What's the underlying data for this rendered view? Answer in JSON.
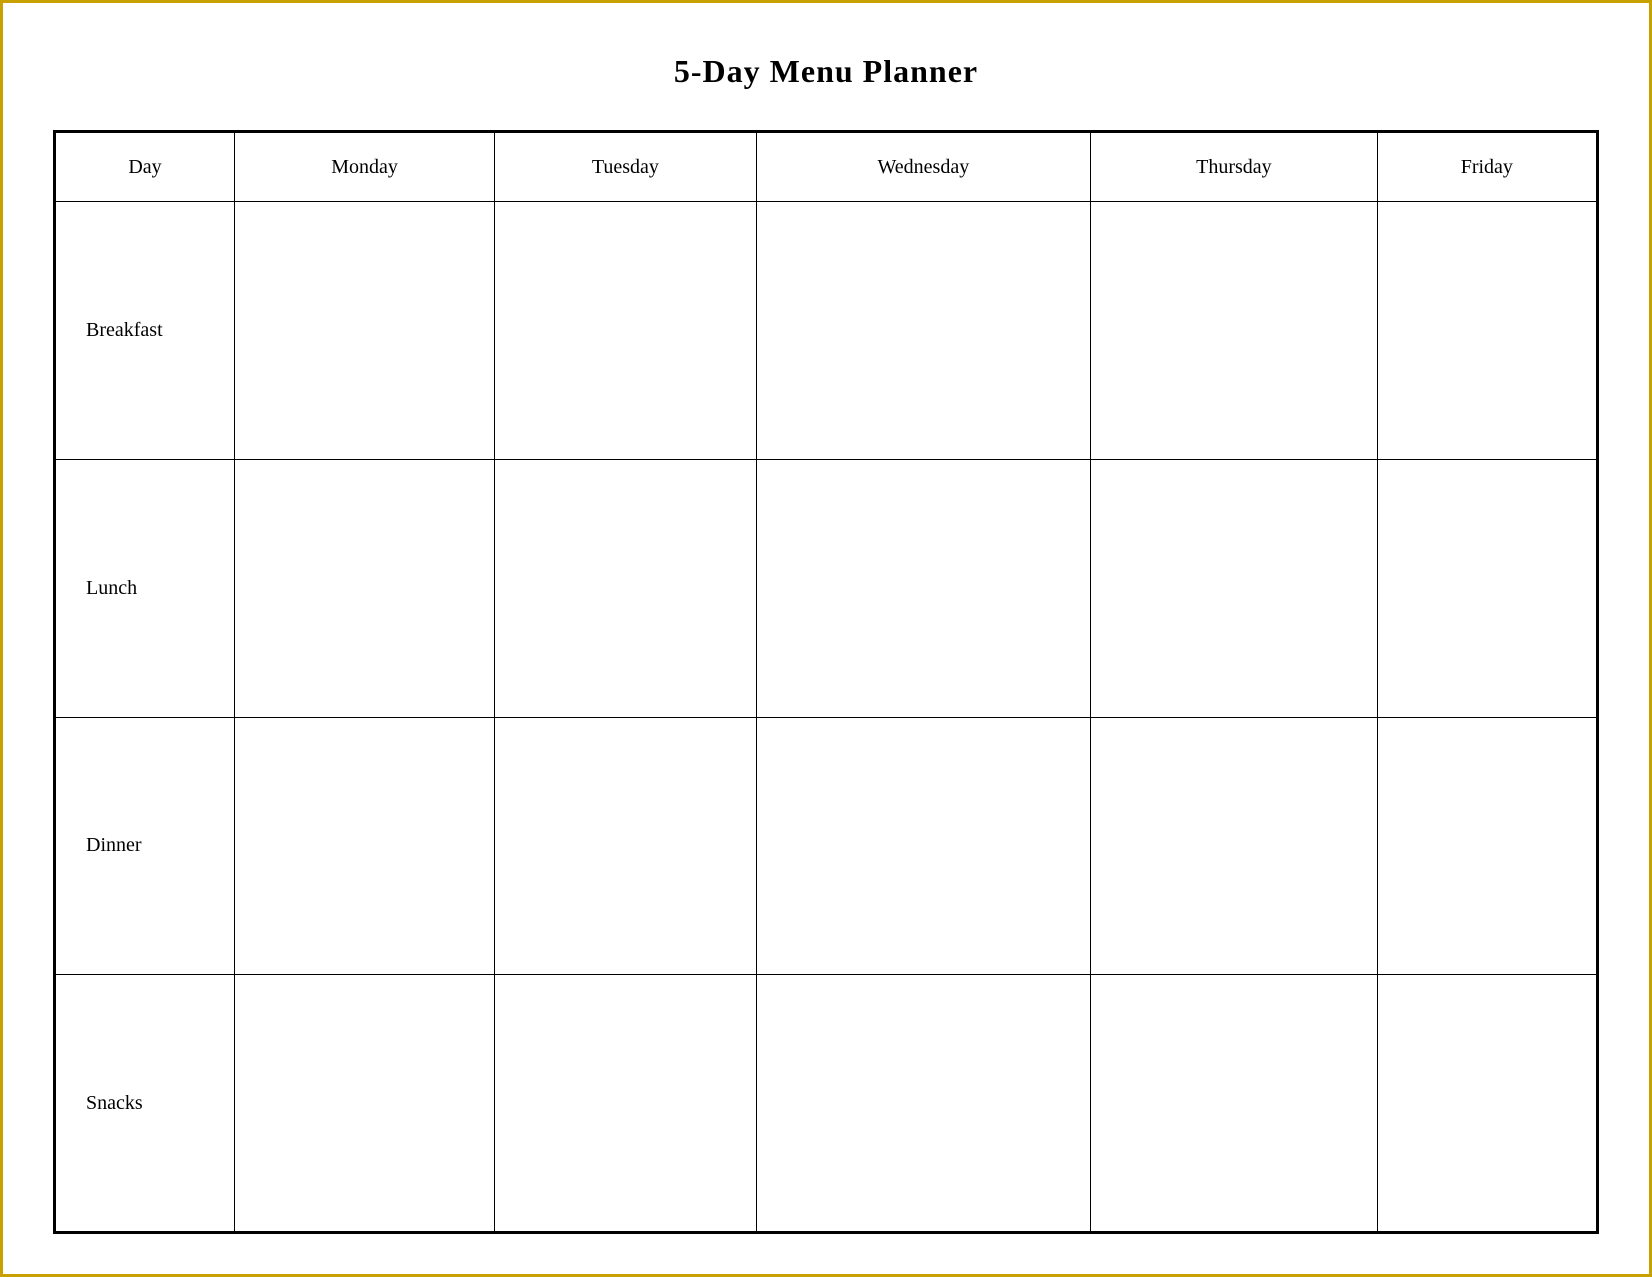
{
  "title": "5-Day Menu Planner",
  "columns": {
    "day": "Day",
    "monday": "Monday",
    "tuesday": "Tuesday",
    "wednesday": "Wednesday",
    "thursday": "Thursday",
    "friday": "Friday"
  },
  "rows": [
    {
      "id": "breakfast",
      "label": "Breakfast"
    },
    {
      "id": "lunch",
      "label": "Lunch"
    },
    {
      "id": "dinner",
      "label": "Dinner"
    },
    {
      "id": "snacks",
      "label": "Snacks"
    }
  ]
}
